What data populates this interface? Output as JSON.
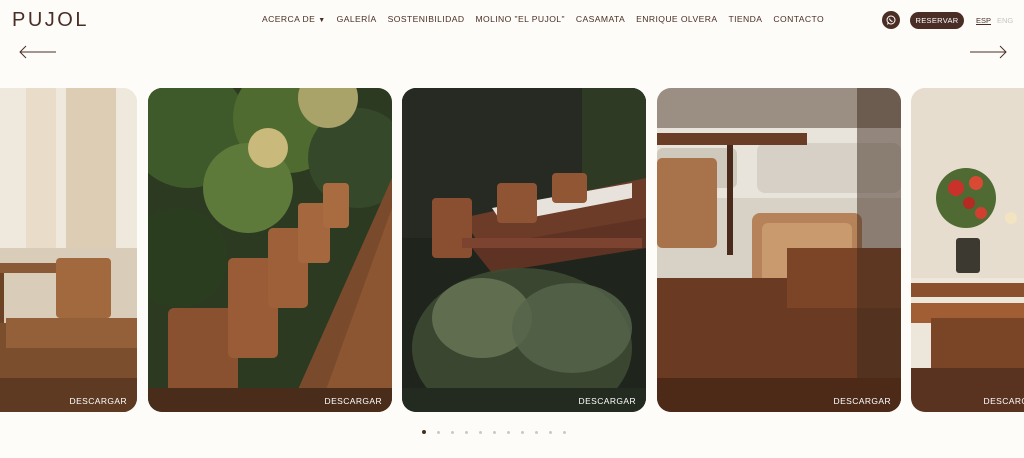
{
  "brand": {
    "logo_text": "PUJOL"
  },
  "nav": {
    "items": [
      "ACERCA DE",
      "GALERÍA",
      "SOSTENIBILIDAD",
      "MOLINO \"EL PUJOL\"",
      "CASAMATA",
      "ENRIQUE OLVERA",
      "TIENDA",
      "CONTACTO"
    ],
    "dropdown_icon": "chevron-down-icon"
  },
  "header_actions": {
    "whatsapp_icon": "whatsapp-icon",
    "reserve_label": "RESERVAR",
    "lang_active": "ESP",
    "lang_inactive": "ENG"
  },
  "carousel": {
    "prev_icon": "arrow-left-icon",
    "next_icon": "arrow-right-icon",
    "slides": [
      {
        "download_label": "DESCARGAR"
      },
      {
        "download_label": "DESCARGAR"
      },
      {
        "download_label": "DESCARGAR"
      },
      {
        "download_label": "DESCARGAR"
      },
      {
        "download_label": "DESCARGAR"
      }
    ],
    "page_count": 11,
    "active_page": 1
  },
  "colors": {
    "brand": "#4a2e25",
    "background": "#fdfcf8",
    "dot_inactive": "#cfc9c1"
  }
}
